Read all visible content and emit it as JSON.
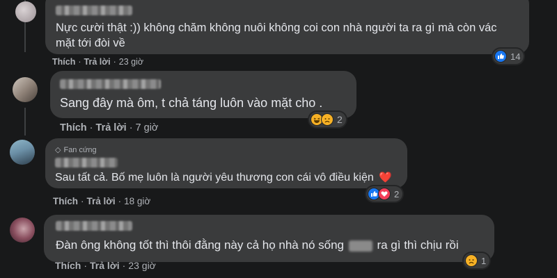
{
  "comments": [
    {
      "text_line1": "Nực cười thật :)) không chăm không nuôi không coi con nhà người ta ra gì mà còn vác",
      "text_line2": "mặt tới đòi về",
      "like_label": "Thích",
      "reply_label": "Trả lời",
      "time": "23 giờ",
      "reactions": [
        "like-icon"
      ],
      "reaction_count": "14"
    },
    {
      "text_line1": "Sang đây mà ôm, t chả táng luôn vào mặt cho .",
      "like_label": "Thích",
      "reply_label": "Trả lời",
      "time": "7 giờ",
      "reactions": [
        "haha-icon",
        "sad-icon"
      ],
      "reaction_count": "2"
    },
    {
      "badge": "Fan cứng",
      "text_line1": "Sau tất cả. Bố mẹ luôn là người yêu thương con cái vô điều kiện",
      "text_emoji": "❤️",
      "like_label": "Thích",
      "reply_label": "Trả lời",
      "time": "18 giờ",
      "reactions": [
        "like-icon",
        "love-icon"
      ],
      "reaction_count": "2"
    },
    {
      "text_line1_a": "Đàn ông không tốt thì thôi đằng này cả họ nhà nó sống",
      "text_line1_b": "ra gì thì chịu rồi",
      "like_label": "Thích",
      "reply_label": "Trả lời",
      "time": "23 giờ",
      "reactions": [
        "sad-icon"
      ],
      "reaction_count": "1"
    }
  ],
  "colors": {
    "background": "#18191a",
    "bubble": "#3a3b3c",
    "text": "#e4e6eb",
    "secondary_text": "#b0b3b8",
    "like_blue": "#1877f2",
    "love_red": "#f33e58",
    "emoji_yellow": "#f7b125"
  }
}
